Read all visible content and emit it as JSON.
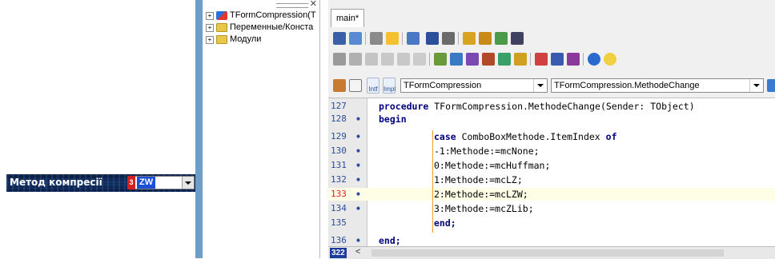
{
  "form": {
    "method_label": "Метод компресії",
    "combo_badge": "3",
    "combo_value": "ZW"
  },
  "tree": {
    "close_glyph": "✕",
    "items": [
      {
        "label": "TFormCompression(T",
        "icon": "component-icon"
      },
      {
        "label": "Переменные/Конста",
        "icon": "folder-icon"
      },
      {
        "label": "Модули",
        "icon": "folder-icon"
      }
    ]
  },
  "editor": {
    "tab_label": "main*",
    "class_combo": "TFormCompression",
    "method_combo": "TFormCompression.MethodeChange",
    "intf_label": "Intf",
    "impl_label": "Impl",
    "lines": [
      {
        "num": "127",
        "marker": "",
        "code": "procedure TFormCompression.MethodeChange(Sender: TObject)"
      },
      {
        "num": "128",
        "marker": "•",
        "code": "begin"
      },
      {
        "num": "129",
        "marker": "•",
        "code": "case ComboBoxMethode.ItemIndex of"
      },
      {
        "num": "130",
        "marker": "•",
        "code": "-1:Methode:=mcNone;"
      },
      {
        "num": "131",
        "marker": "•",
        "code": "0:Methode:=mcHuffman;"
      },
      {
        "num": "132",
        "marker": "•",
        "code": "1:Methode:=mcLZ;"
      },
      {
        "num": "133",
        "marker": "•",
        "code": "2:Methode:=mcLZW;"
      },
      {
        "num": "134",
        "marker": "•",
        "code": "3:Methode:=mcZLib;"
      },
      {
        "num": "135",
        "marker": "",
        "code": "end;"
      },
      {
        "num": "136",
        "marker": "•",
        "code": "end;"
      }
    ],
    "status_count": "322",
    "scroll_left": "<"
  },
  "colors": {
    "accent_blue": "#1a4fd6",
    "keyword": "#00007f",
    "current_line": "#fefee6",
    "line_number": "#2a4d9a",
    "line_number_error": "#dd2222"
  }
}
